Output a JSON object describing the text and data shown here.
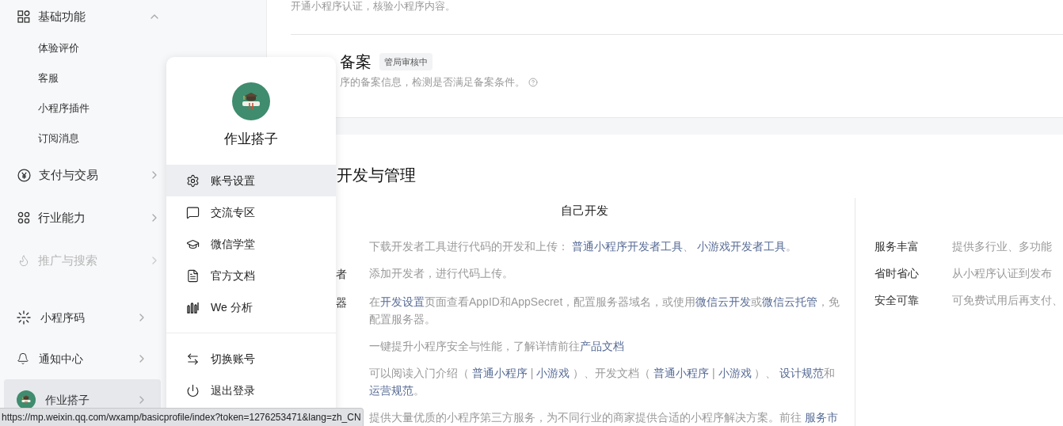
{
  "sidebar": {
    "items": [
      {
        "label": "基础功能",
        "expanded": true,
        "disabled": false,
        "children": [
          {
            "label": "体验评价"
          },
          {
            "label": "客服"
          },
          {
            "label": "小程序插件"
          },
          {
            "label": "订阅消息"
          }
        ]
      },
      {
        "label": "支付与交易",
        "expanded": false,
        "disabled": false
      },
      {
        "label": "行业能力",
        "expanded": false,
        "disabled": false
      },
      {
        "label": "推广与搜索",
        "expanded": false,
        "disabled": true
      }
    ],
    "bottom_items": [
      {
        "label": "小程序码",
        "selected": false
      },
      {
        "label": "通知中心",
        "selected": false
      },
      {
        "label": "作业搭子",
        "selected": true
      }
    ]
  },
  "main": {
    "intro_text": "开通小程序认证，核验小程序内容。",
    "filing": {
      "title": "备案",
      "badge": "管局审核中",
      "description": "序的备案信息，检测是否满足备案条件。"
    },
    "dev_section": {
      "title": "开发与管理",
      "self_dev": {
        "heading": "自己开发",
        "rows": [
          {
            "parts": [
              {
                "kind": "text",
                "text": "下载开发者工具进行代码的开发和上传： "
              },
              {
                "kind": "link",
                "text": "普通小程序开发者工具"
              },
              {
                "kind": "text",
                "text": "、 "
              },
              {
                "kind": "link",
                "text": "小游戏开发者工具"
              },
              {
                "kind": "text",
                "text": "。"
              }
            ]
          },
          {
            "label": "者",
            "parts": [
              {
                "kind": "text",
                "text": "添加开发者，进行代码上传。"
              }
            ]
          },
          {
            "label": "器",
            "parts": [
              {
                "kind": "text",
                "text": "在"
              },
              {
                "kind": "link",
                "text": "开发设置"
              },
              {
                "kind": "text",
                "text": "页面查看AppID和AppSecret，配置服务器域名，或使用"
              },
              {
                "kind": "link",
                "text": "微信云开发"
              },
              {
                "kind": "text",
                "text": "或"
              },
              {
                "kind": "link",
                "text": "微信云托管"
              },
              {
                "kind": "text",
                "text": "，免配置服务器。"
              }
            ]
          },
          {
            "parts": [
              {
                "kind": "text",
                "text": "一键提升小程序安全与性能，了解详情前往"
              },
              {
                "kind": "link",
                "text": "产品文档"
              }
            ]
          },
          {
            "parts": [
              {
                "kind": "text",
                "text": "可以阅读入门介绍（ "
              },
              {
                "kind": "link",
                "text": "普通小程序"
              },
              {
                "kind": "text",
                "text": " | "
              },
              {
                "kind": "link",
                "text": "小游戏"
              },
              {
                "kind": "text",
                "text": " ）、开发文档（ "
              },
              {
                "kind": "link",
                "text": "普通小程序"
              },
              {
                "kind": "text",
                "text": " | "
              },
              {
                "kind": "link",
                "text": "小游戏"
              },
              {
                "kind": "text",
                "text": " ）、 "
              },
              {
                "kind": "link",
                "text": "设计规范"
              },
              {
                "kind": "text",
                "text": "和"
              },
              {
                "kind": "link",
                "text": "运营规范"
              },
              {
                "kind": "text",
                "text": "。"
              }
            ]
          },
          {
            "parts": [
              {
                "kind": "text",
                "text": "提供大量优质的小程序第三方服务，为不同行业的商家提供合适的小程序解决方案。前往 "
              },
              {
                "kind": "link",
                "text": "服务市"
              }
            ]
          }
        ]
      },
      "service": {
        "rows": [
          {
            "label": "服务丰富",
            "description": "提供多行业、多功能"
          },
          {
            "label": "省时省心",
            "description": "从小程序认证到发布"
          },
          {
            "label": "安全可靠",
            "description": "可免费试用后再支付、"
          }
        ]
      }
    }
  },
  "account_menu": {
    "name": "作业搭子",
    "items": [
      {
        "label": "账号设置",
        "selected": true
      },
      {
        "label": "交流专区",
        "selected": false
      },
      {
        "label": "微信学堂",
        "selected": false
      },
      {
        "label": "官方文档",
        "selected": false
      },
      {
        "label": "We 分析",
        "selected": false
      }
    ],
    "footer_items": [
      {
        "label": "切换账号",
        "selected": false
      },
      {
        "label": "退出登录",
        "selected": false
      }
    ]
  },
  "status_bar": {
    "url": "https://mp.weixin.qq.com/wxamp/basicprofile/index?token=1276253471&lang=zh_CN"
  }
}
